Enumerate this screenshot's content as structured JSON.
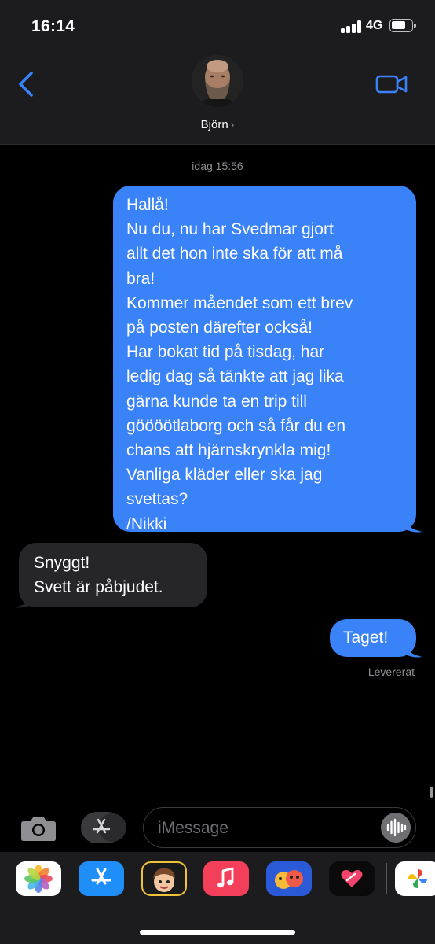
{
  "status_bar": {
    "time": "16:14",
    "network": "4G"
  },
  "header": {
    "contact_name": "Björn",
    "chevron": "›"
  },
  "conversation": {
    "timestamp": "idag 15:56",
    "messages": [
      {
        "direction": "sent",
        "lines": [
          "Hallå!",
          "Nu du, nu har Svedmar gjort",
          "allt det hon inte ska för att må",
          "bra!",
          "Kommer måendet som ett brev",
          "på posten därefter också!",
          "Har bokat tid på tisdag, har",
          "ledig dag så tänkte att jag lika",
          "gärna kunde ta en trip till",
          "göööötlaborg och så får du en",
          "chans att hjärnskrynkla mig!",
          "Vanliga kläder eller ska jag",
          "svettas?",
          "/Nikki"
        ]
      },
      {
        "direction": "received",
        "lines": [
          "Snyggt!",
          "Svett är påbjudet."
        ]
      },
      {
        "direction": "sent",
        "lines": [
          "Taget!"
        ]
      }
    ],
    "delivery_status": "Levererat"
  },
  "input_bar": {
    "placeholder": "iMessage"
  },
  "app_drawer": {
    "apps": [
      "photos-app",
      "app-store-app",
      "memoji-stickers-app",
      "music-app",
      "animoji-app",
      "digital-touch-app",
      "google-photos-app"
    ]
  },
  "colors": {
    "sent_bubble": "#3a82f7",
    "received_bubble": "#262628",
    "background": "#000000",
    "header_background": "#1c1c1e",
    "accent": "#3a82f7"
  }
}
